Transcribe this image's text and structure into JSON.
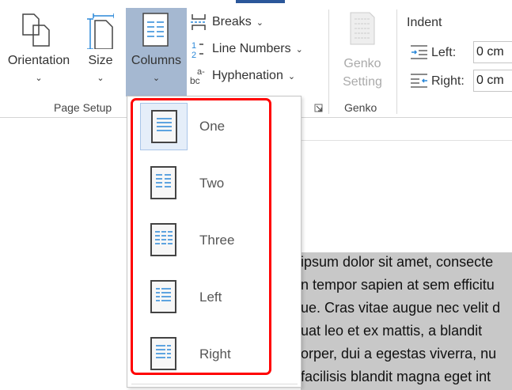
{
  "ribbon": {
    "orientation": "Orientation",
    "size": "Size",
    "columns": "Columns",
    "breaks": "Breaks",
    "line_numbers": "Line Numbers",
    "hyphenation": "Hyphenation",
    "page_setup_group": "Page Setup",
    "genko_setting": [
      "Genko",
      "Setting"
    ],
    "genko_group": "Genko",
    "indent_title": "Indent",
    "left_label": "Left:",
    "right_label": "Right:",
    "left_value": "0 cm",
    "right_value": "0 cm",
    "chevron": "⌄"
  },
  "columns_menu": {
    "items": [
      {
        "label": "One",
        "selected": true
      },
      {
        "label": "Two"
      },
      {
        "label": "Three"
      },
      {
        "label": "Left"
      },
      {
        "label": "Right"
      }
    ]
  },
  "document": {
    "lines": [
      "ipsum dolor sit amet, consecte",
      "n tempor sapien at sem efficitu",
      "ue. Cras vitae augue nec velit d",
      "uat leo et ex mattis, a blandit",
      "orper, dui a egestas viverra, nu",
      "facilisis blandit magna eget int"
    ]
  },
  "colors": {
    "accent": "#2b579a",
    "highlight": "#f00",
    "selected_btn": "#a5b8d1"
  }
}
